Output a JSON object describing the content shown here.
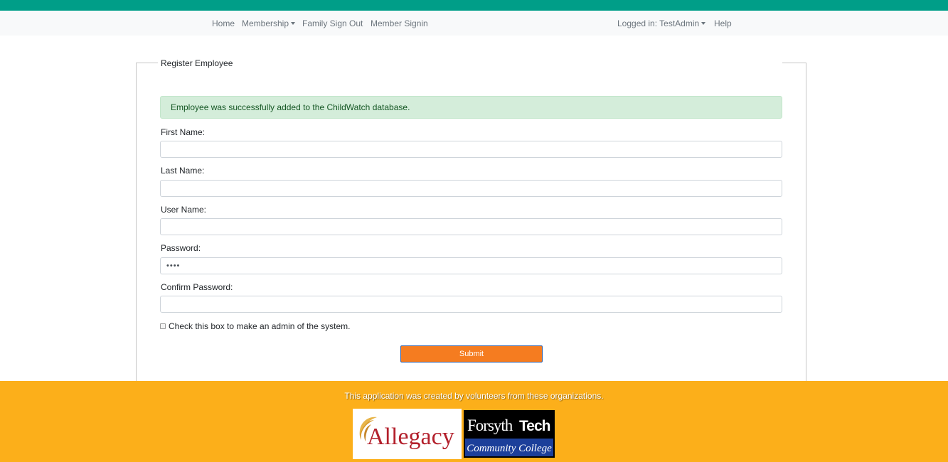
{
  "nav": {
    "home": "Home",
    "membership": "Membership",
    "family_sign_out": "Family Sign Out",
    "member_signin": "Member Signin",
    "logged_in": "Logged in: TestAdmin",
    "help": "Help"
  },
  "form": {
    "legend": "Register Employee",
    "alert": "Employee was successfully added to the ChildWatch database.",
    "first_name_label": "First Name:",
    "first_name_value": "",
    "last_name_label": "Last Name:",
    "last_name_value": "",
    "user_name_label": "User Name:",
    "user_name_value": "",
    "password_label": "Password:",
    "password_value": "••••",
    "confirm_password_label": "Confirm Password:",
    "confirm_password_value": "",
    "admin_checkbox_label": "Check this box to make an admin of the system.",
    "admin_checked": false,
    "submit_label": "Submit"
  },
  "footer": {
    "text": "This application was created by volunteers from these organizations.",
    "logos": {
      "allegacy": "Allegacy",
      "forsyth_top_a": "Forsyth",
      "forsyth_top_b": "Tech",
      "forsyth_bottom": "Community College"
    }
  },
  "colors": {
    "topbar": "#009e88",
    "navbar": "#f8f9fa",
    "alert_bg": "#d4edda",
    "alert_text": "#155724",
    "submit_bg": "#f57c20",
    "footer_bg": "#fcaf1a",
    "allegacy_red": "#b3202c",
    "forsyth_blue": "#1c3f9a"
  }
}
